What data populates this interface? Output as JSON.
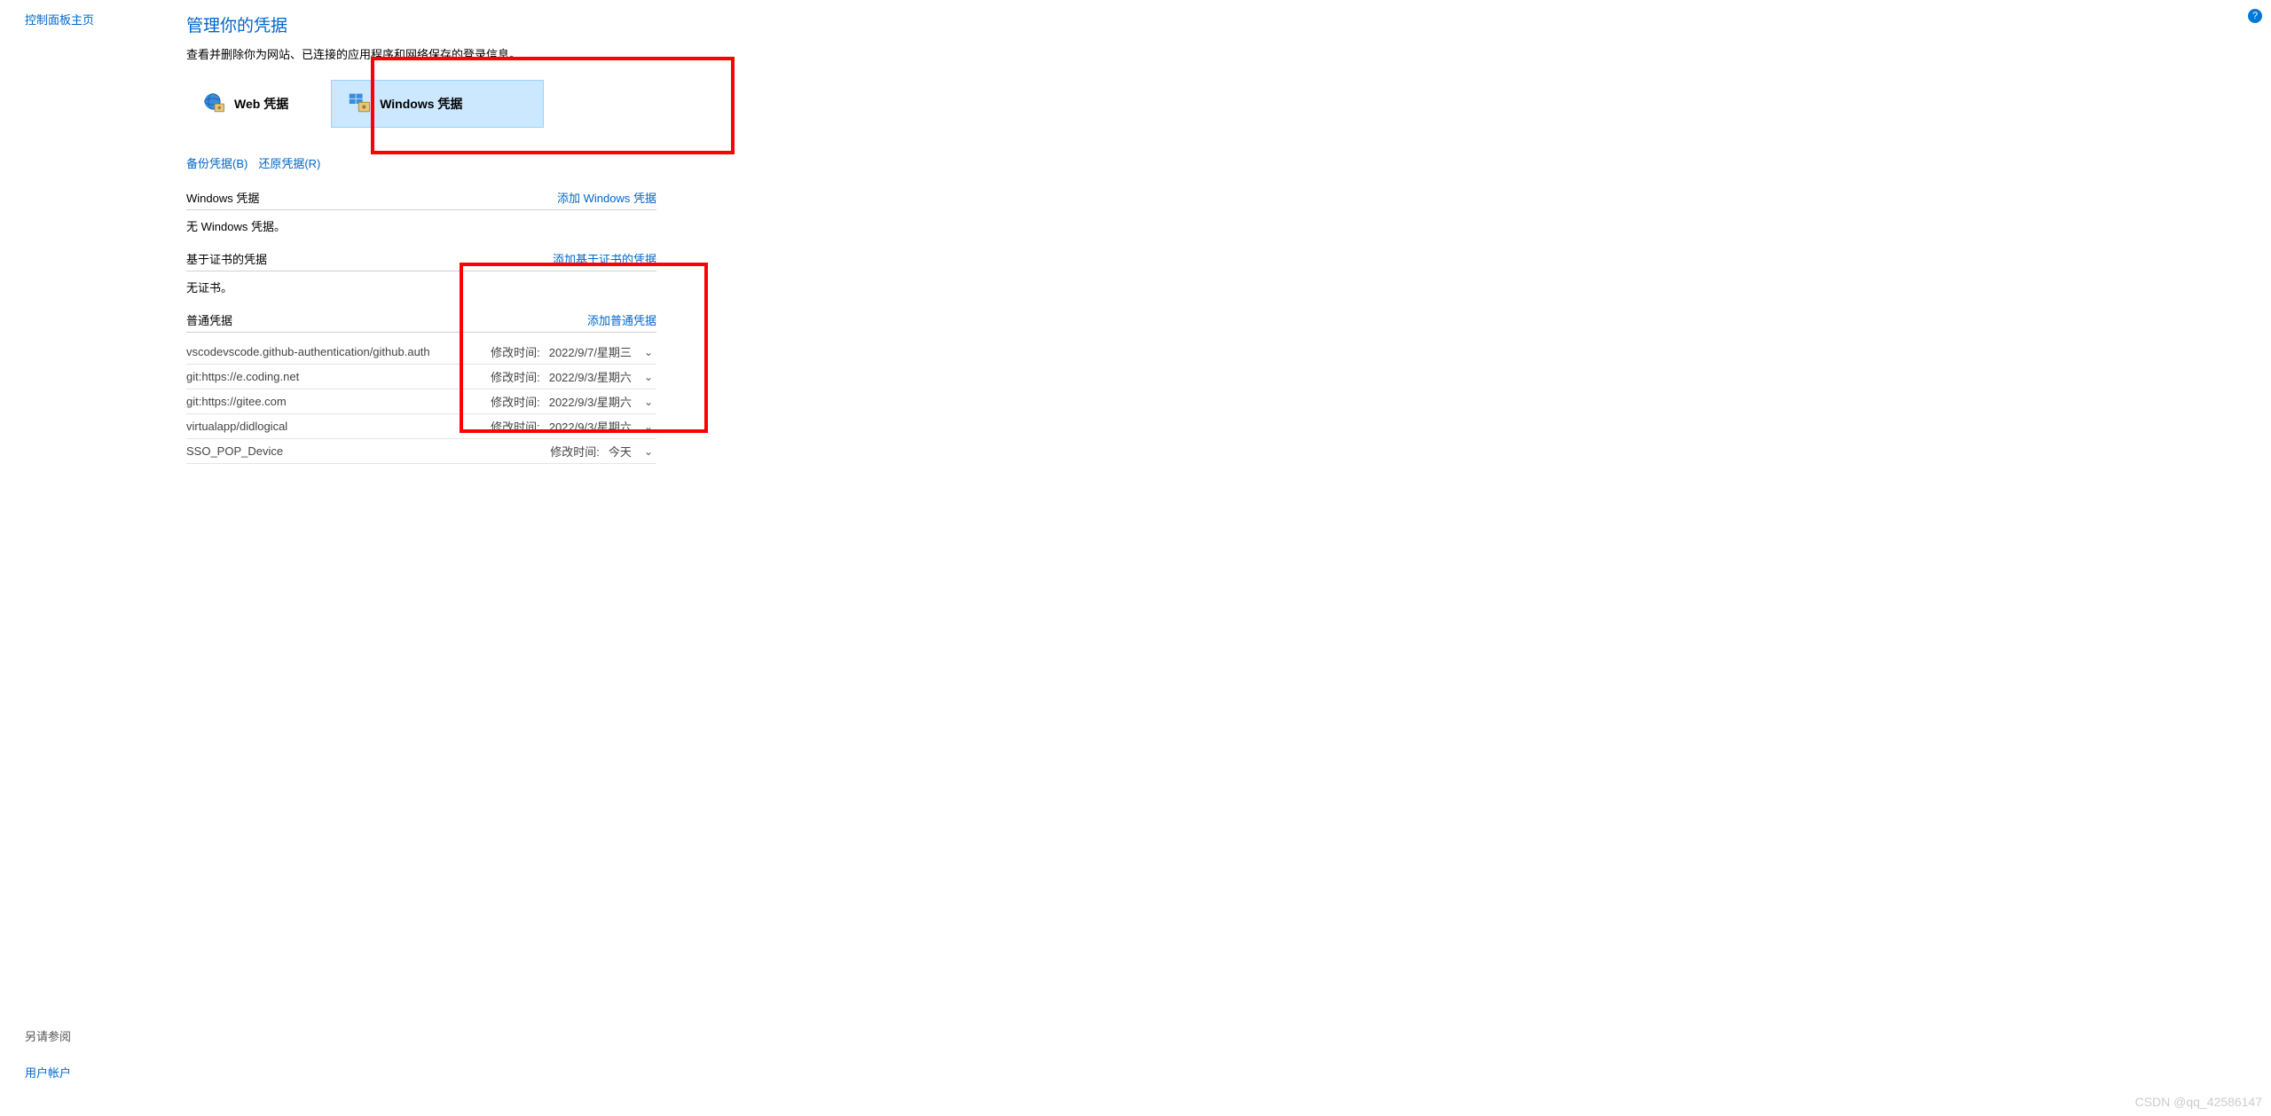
{
  "sidebar": {
    "home_link": "控制面板主页",
    "see_also": "另请参阅",
    "user_account": "用户帐户"
  },
  "page": {
    "title": "管理你的凭据",
    "desc": "查看并删除你为网站、已连接的应用程序和网络保存的登录信息。"
  },
  "tabs": {
    "web": "Web 凭据",
    "windows": "Windows 凭据"
  },
  "backup": {
    "backup": "备份凭据(B)",
    "restore": "还原凭据(R)"
  },
  "sections": {
    "windows": {
      "title": "Windows 凭据",
      "add": "添加 Windows 凭据",
      "empty": "无 Windows 凭据。"
    },
    "cert": {
      "title": "基于证书的凭据",
      "add": "添加基于证书的凭据",
      "empty": "无证书。"
    },
    "generic": {
      "title": "普通凭据",
      "add": "添加普通凭据"
    }
  },
  "modified_label": "修改时间:",
  "credentials": [
    {
      "name": "vscodevscode.github-authentication/github.auth",
      "date": "2022/9/7/星期三"
    },
    {
      "name": "git:https://e.coding.net",
      "date": "2022/9/3/星期六"
    },
    {
      "name": "git:https://gitee.com",
      "date": "2022/9/3/星期六"
    },
    {
      "name": "virtualapp/didlogical",
      "date": "2022/9/3/星期六"
    },
    {
      "name": "SSO_POP_Device",
      "date": "今天"
    }
  ],
  "help": "?",
  "watermark": "CSDN @qq_42586147"
}
